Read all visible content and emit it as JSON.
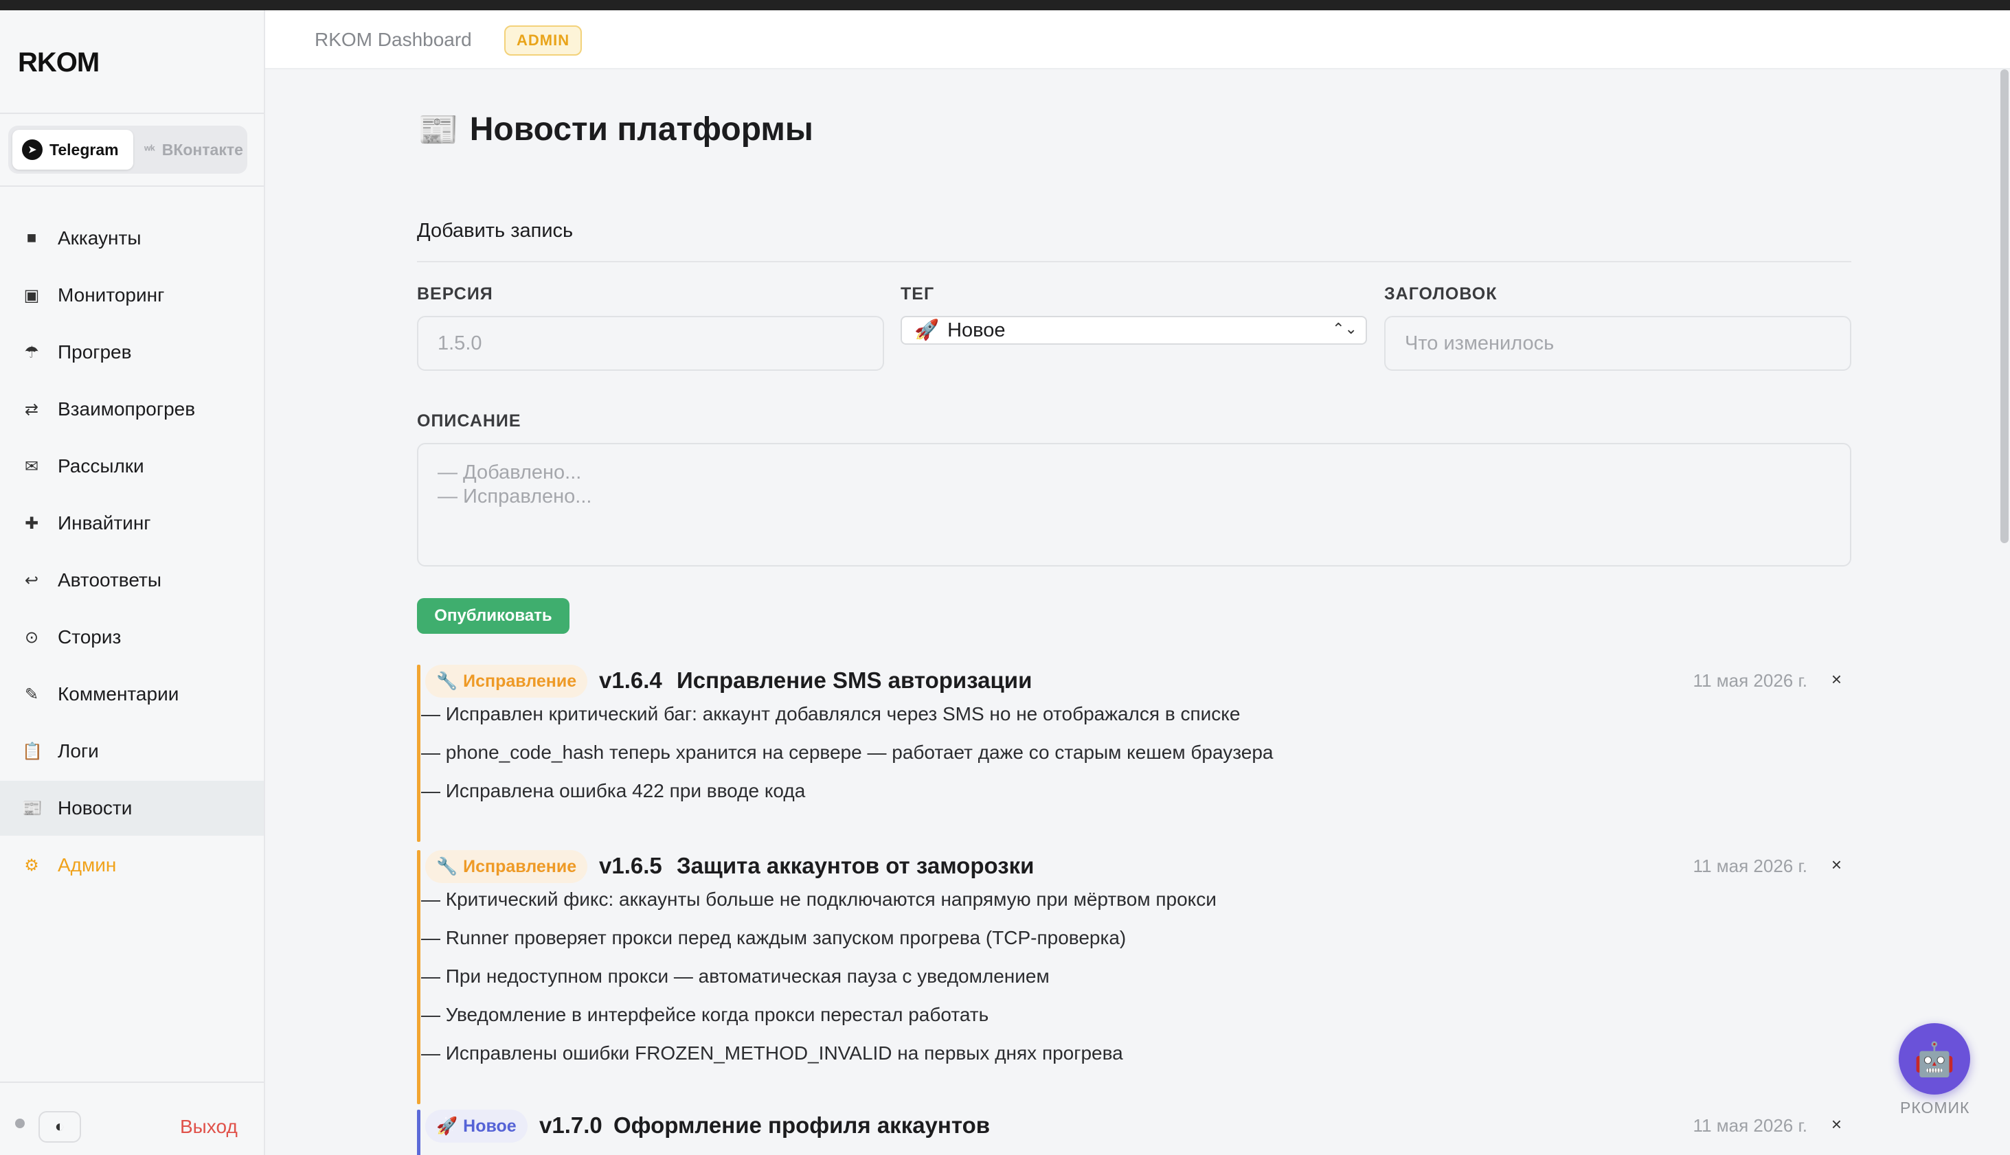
{
  "app": {
    "logo": "RKOM"
  },
  "platforms": [
    {
      "label": "Telegram",
      "icon": "telegram-icon",
      "active": true
    },
    {
      "label": "ВКонтакте",
      "icon": "vk-icon",
      "active": false
    }
  ],
  "nav": [
    {
      "label": "Аккаунты",
      "icon": "■",
      "name": "accounts"
    },
    {
      "label": "Мониторинг",
      "icon": "▣",
      "name": "monitoring"
    },
    {
      "label": "Прогрев",
      "icon": "☂",
      "name": "warmup"
    },
    {
      "label": "Взаимопрогрев",
      "icon": "⇄",
      "name": "mutual-warmup"
    },
    {
      "label": "Рассылки",
      "icon": "✉",
      "name": "mailings"
    },
    {
      "label": "Инвайтинг",
      "icon": "✚",
      "name": "inviting"
    },
    {
      "label": "Автоответы",
      "icon": "↩",
      "name": "autoreplies"
    },
    {
      "label": "Сториз",
      "icon": "⊙",
      "name": "stories"
    },
    {
      "label": "Комментарии",
      "icon": "✎",
      "name": "comments"
    },
    {
      "label": "Логи",
      "icon": "📋",
      "name": "logs"
    },
    {
      "label": "Новости",
      "icon": "📰",
      "name": "news",
      "active": true
    },
    {
      "label": "Админ",
      "icon": "⚙",
      "name": "admin",
      "admin": true
    }
  ],
  "footer": {
    "logout": "Выход",
    "theme_icon": "◐"
  },
  "header": {
    "title": "RKOM Dashboard",
    "badge": "ADMIN"
  },
  "page": {
    "title": "Новости платформы",
    "icon": "📰"
  },
  "form": {
    "section_title": "Добавить запись",
    "version_label": "ВЕРСИЯ",
    "version_placeholder": "1.5.0",
    "tag_label": "ТЕГ",
    "tag_selected": "Новое",
    "tag_icon": "🚀",
    "title_label": "ЗАГОЛОВОК",
    "title_placeholder": "Что изменилось",
    "description_label": "ОПИСАНИЕ",
    "description_placeholder_lines": [
      "— Добавлено...",
      "— Исправлено..."
    ],
    "publish_label": "Опубликовать"
  },
  "entries": [
    {
      "kind": "fix",
      "tag": "Исправление",
      "tag_icon": "🔧",
      "version": "v1.6.4",
      "title": "Исправление SMS авторизации",
      "date": "11 мая 2026 г.",
      "lines": [
        "— Исправлен критический баг: аккаунт добавлялся через SMS но не отображался в списке",
        "— phone_code_hash теперь хранится на сервере — работает даже со старым кешем браузера",
        "— Исправлена ошибка 422 при вводе кода"
      ]
    },
    {
      "kind": "fix",
      "tag": "Исправление",
      "tag_icon": "🔧",
      "version": "v1.6.5",
      "title": "Защита аккаунтов от заморозки",
      "date": "11 мая 2026 г.",
      "lines": [
        "— Критический фикс: аккаунты больше не подключаются напрямую при мёртвом прокси",
        "— Runner проверяет прокси перед каждым запуском прогрева (TCP-проверка)",
        "— При недоступном прокси — автоматическая пауза с уведомлением",
        "— Уведомление в интерфейсе когда прокси перестал работать",
        "— Исправлены ошибки FROZEN_METHOD_INVALID на первых днях прогрева"
      ]
    },
    {
      "kind": "new",
      "tag": "Новое",
      "tag_icon": "🚀",
      "version": "v1.7.0",
      "title": "Оформление профиля аккаунтов",
      "date": "11 мая 2026 г.",
      "lines": []
    }
  ],
  "delete_glyph": "×",
  "bot": {
    "label": "РКОМИК",
    "icon": "🤖"
  },
  "colors": {
    "fix": "#f2a531",
    "new": "#5c6ad8",
    "publish": "#3fae6e",
    "admin": "#f0a21a",
    "logout": "#e0524a",
    "bot": "#6a52d9"
  }
}
